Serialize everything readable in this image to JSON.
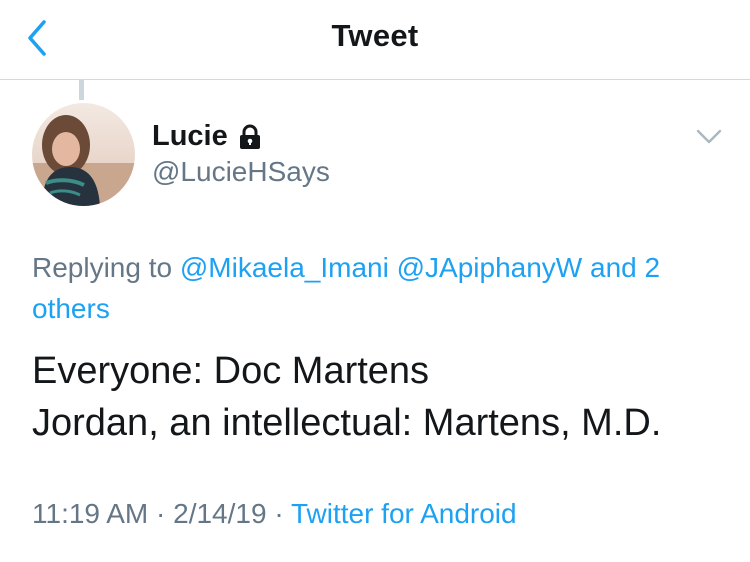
{
  "header": {
    "title": "Tweet",
    "back_icon": "chevron-left-icon",
    "accent_color": "#1da1f2"
  },
  "tweet": {
    "name": "Lucie",
    "lock_icon": "lock-icon",
    "handle": "@LucieHSays",
    "menu_icon": "chevron-down-icon",
    "reply_prefix": "Replying to",
    "mentions": [
      "@Mikaela_Imani",
      "@JApiphanyW"
    ],
    "and_others": "and 2 others",
    "lines": [
      "Everyone: Doc Martens",
      "Jordan, an intellectual: Martens, M.D."
    ],
    "time": "11:19 AM",
    "sep": "·",
    "date": "2/14/19",
    "source": "Twitter for Android"
  }
}
